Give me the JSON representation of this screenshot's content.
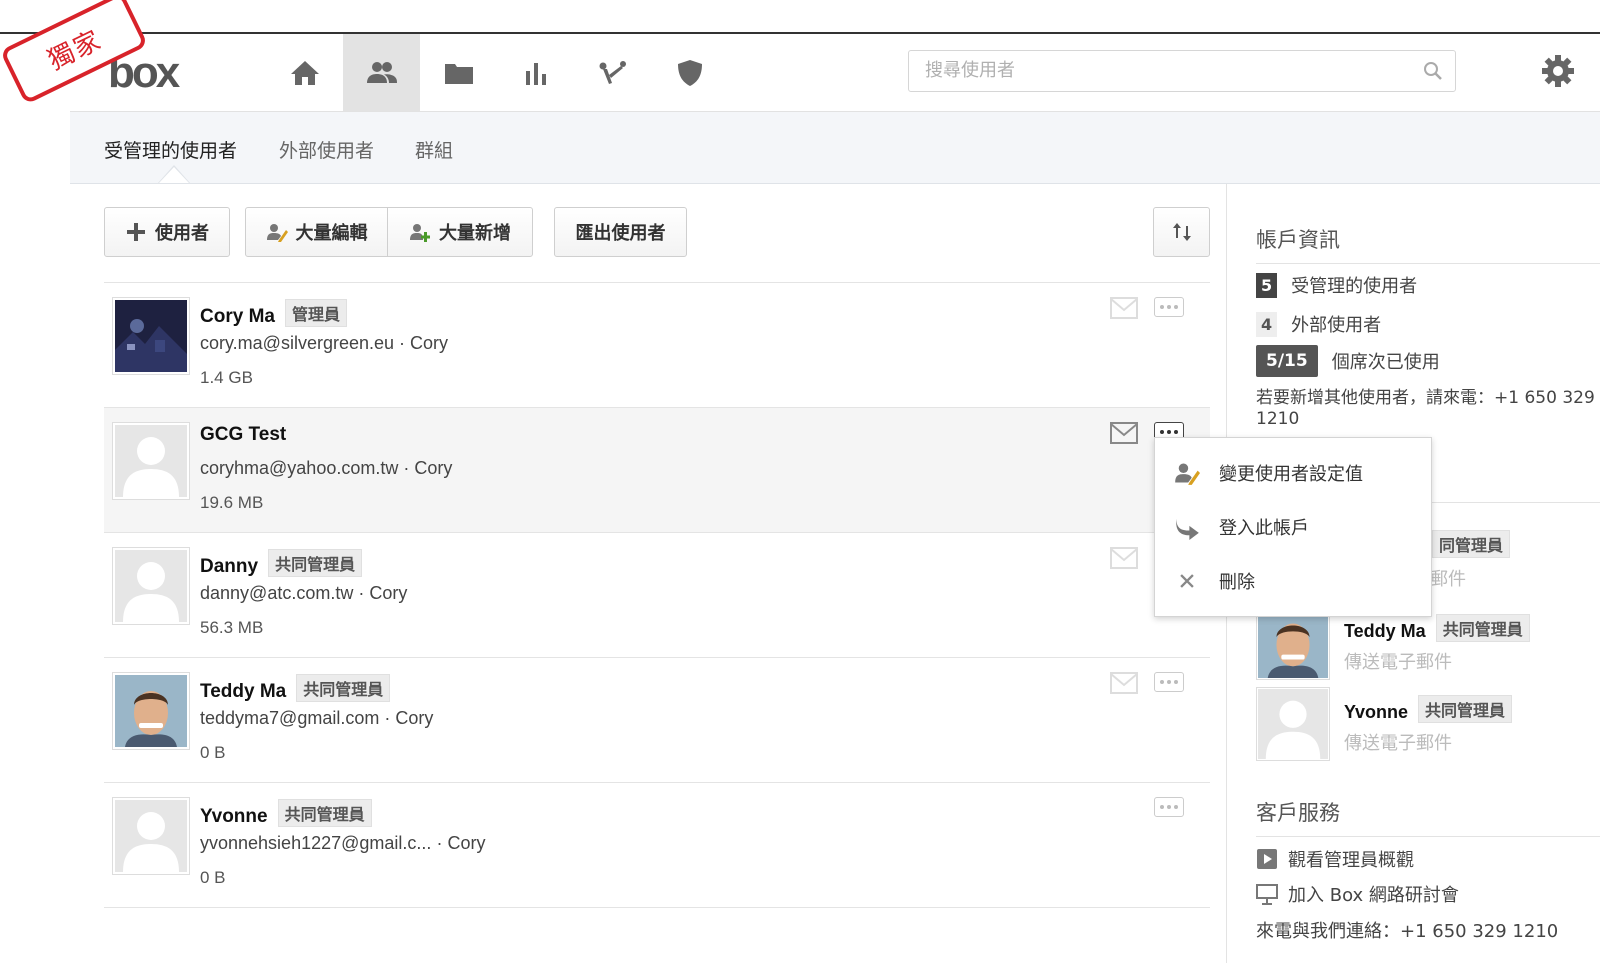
{
  "stamp": "獨家",
  "app": {
    "logo": "box"
  },
  "search": {
    "placeholder": "搜尋使用者"
  },
  "subnav": {
    "tabs": [
      "受管理的使用者",
      "外部使用者",
      "群組"
    ]
  },
  "toolbar": {
    "add_user": "使用者",
    "bulk_edit": "大量編輯",
    "bulk_add": "大量新增",
    "export": "匯出使用者"
  },
  "users": [
    {
      "name": "Cory Ma",
      "role": "管理員",
      "email": "cory.ma@silvergreen.eu",
      "owner": "Cory",
      "size": "1.4 GB"
    },
    {
      "name": "GCG Test",
      "role": "",
      "email": "coryhma@yahoo.com.tw",
      "owner": "Cory",
      "size": "19.6 MB"
    },
    {
      "name": "Danny",
      "role": "共同管理員",
      "email": "danny@atc.com.tw",
      "owner": "Cory",
      "size": "56.3 MB"
    },
    {
      "name": "Teddy Ma",
      "role": "共同管理員",
      "email": "teddyma7@gmail.com",
      "owner": "Cory",
      "size": "0 B"
    },
    {
      "name": "Yvonne",
      "role": "共同管理員",
      "email": "yvonnehsieh1227@gmail.c...",
      "owner": "Cory",
      "size": "0 B"
    }
  ],
  "separator": "·",
  "menu": {
    "change_settings": "變更使用者設定值",
    "login_as": "登入此帳戶",
    "delete": "刪除"
  },
  "account": {
    "title": "帳戶資訊",
    "managed_count": "5",
    "managed_label": "受管理的使用者",
    "external_count": "4",
    "external_label": "外部使用者",
    "seats": "5/15",
    "seats_label": "個席次已使用",
    "note": "若要新增其他使用者，請來電：+1 650 329 1210"
  },
  "co_admins": {
    "partial_role": "同管理員",
    "partial_mail": "郵件",
    "items": [
      {
        "name": "Teddy Ma",
        "role": "共同管理員",
        "action": "傳送電子郵件"
      },
      {
        "name": "Yvonne",
        "role": "共同管理員",
        "action": "傳送電子郵件"
      }
    ]
  },
  "support": {
    "title": "客戶服務",
    "watch": "觀看管理員概觀",
    "webinar": "加入 Box 網路研討會",
    "contact": "來電與我們連絡：+1 650 329 1210"
  }
}
